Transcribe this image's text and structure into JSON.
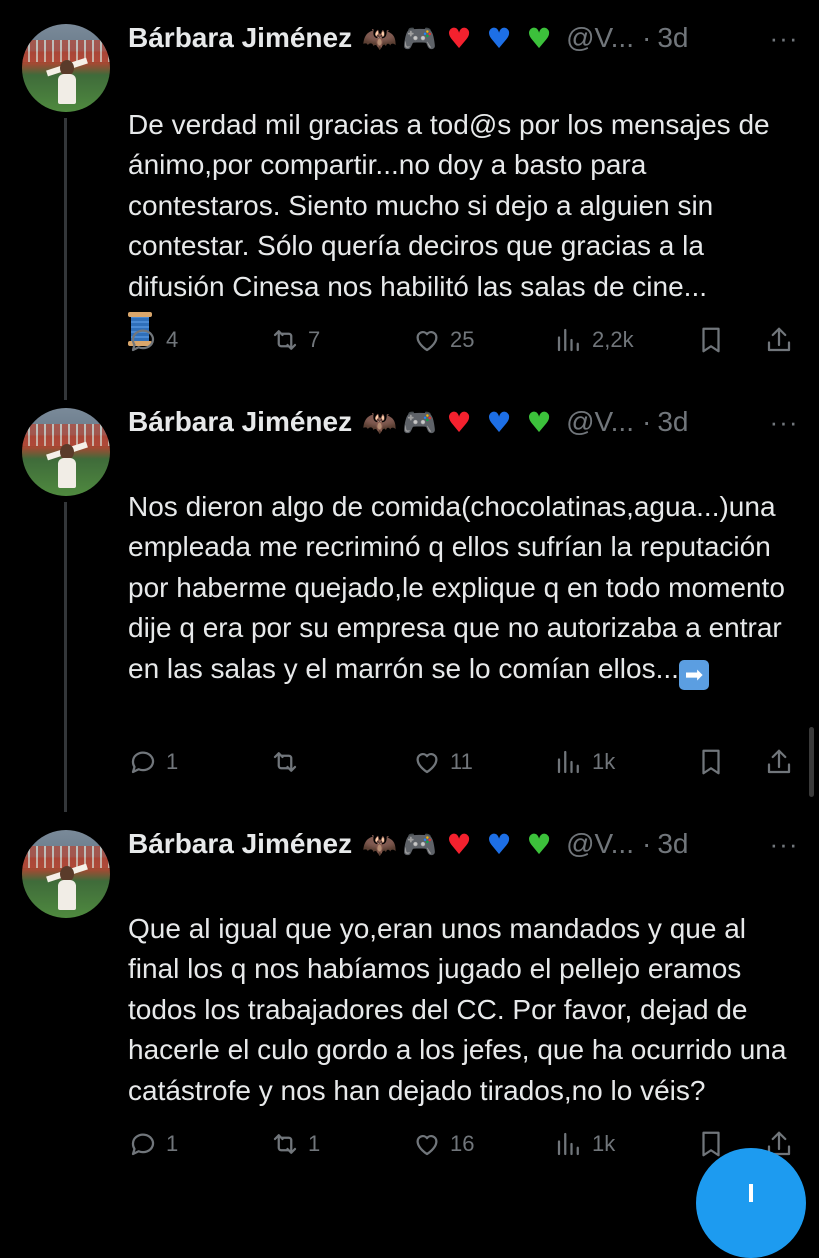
{
  "tweets": [
    {
      "author": "Bárbara Jiménez",
      "handle": "@V...",
      "time": "3d",
      "text": "De verdad mil gracias a tod@s por los mensajes de ánimo,por compartir...no doy a basto para contestaros. Siento mucho si dejo a alguien sin contestar. Sólo quería deciros que gracias a la difusión Cinesa nos habilitó las salas de cine...",
      "trailing_emoji": "spool-of-thread-emoji",
      "replies": "4",
      "reposts": "7",
      "likes": "25",
      "views": "2,2k"
    },
    {
      "author": "Bárbara Jiménez",
      "handle": "@V...",
      "time": "3d",
      "text": "Nos dieron algo de comida(chocolatinas,agua...)una empleada me recriminó q ellos sufrían la reputación por haberme quejado,le explique q en todo momento dije q era por su empresa que no autorizaba a entrar en las salas y el marrón se lo comían ellos...",
      "trailing_emoji": "right-arrow-emoji",
      "replies": "1",
      "reposts": "",
      "likes": "11",
      "views": "1k"
    },
    {
      "author": "Bárbara Jiménez",
      "handle": "@V...",
      "time": "3d",
      "text": "Que al igual que yo,eran unos mandados y que al final los q nos habíamos jugado el pellejo eramos todos los trabajadores del CC. Por favor, dejad de hacerle el culo gordo a los jefes, que ha ocurrido una catástrofe y nos han dejado tirados,no lo véis?",
      "trailing_emoji": "",
      "replies": "1",
      "reposts": "1",
      "likes": "16",
      "views": "1k"
    }
  ],
  "name_emojis": [
    "bat-emoji",
    "game-controller-emoji",
    "red-heart-emoji",
    "blue-heart-emoji",
    "green-heart-emoji"
  ],
  "separator": "·",
  "colors": {
    "background": "#000000",
    "text": "#e7e9ea",
    "muted": "#71767b",
    "accent": "#1d9bf0"
  }
}
